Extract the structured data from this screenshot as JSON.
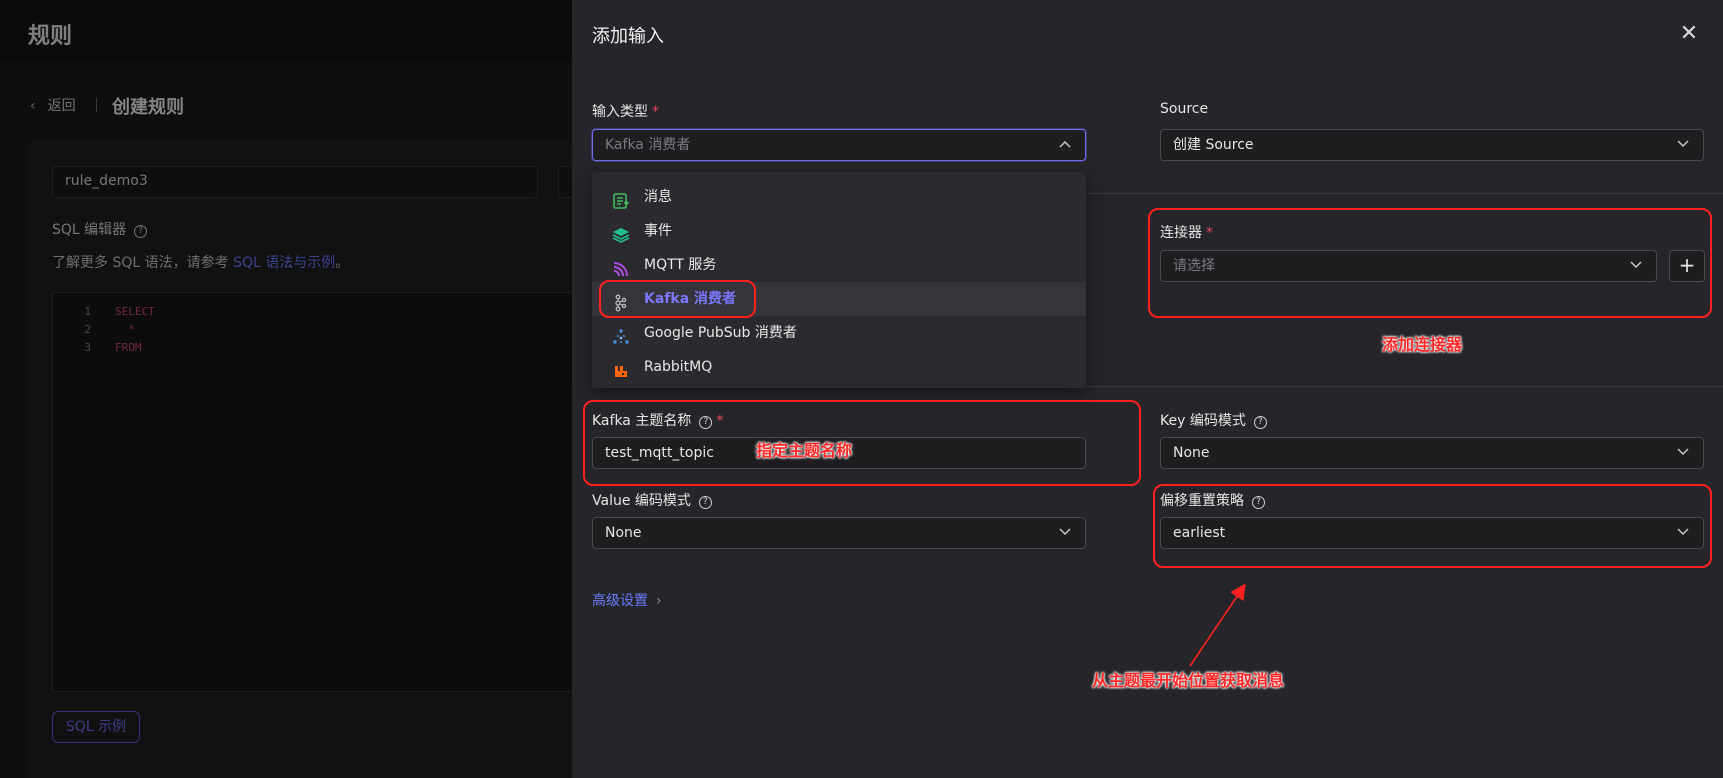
{
  "background": {
    "title": "规则",
    "back_label": "返回",
    "page_title": "创建规则",
    "rule_name": "rule_demo3",
    "sql_editor_label": "SQL 编辑器",
    "sql_help_prefix": "了解更多 SQL 语法，请参考 ",
    "sql_help_link": "SQL 语法与示例",
    "sql_help_suffix": "。",
    "code_lines": [
      {
        "num": "1",
        "text": "SELECT"
      },
      {
        "num": "2",
        "text": "  *"
      },
      {
        "num": "3",
        "text": "FROM"
      }
    ],
    "sql_example_button": "SQL 示例"
  },
  "drawer": {
    "title": "添加输入",
    "close_icon": "close-icon",
    "input_type": {
      "label": "输入类型",
      "placeholder": "Kafka 消费者",
      "options": [
        {
          "label": "消息",
          "icon": "message-icon",
          "color": "#3fbf5f"
        },
        {
          "label": "事件",
          "icon": "layers-icon",
          "color": "#1fbf8f"
        },
        {
          "label": "MQTT 服务",
          "icon": "mqtt-icon",
          "color": "#b04ae0"
        },
        {
          "label": "Kafka 消费者",
          "icon": "kafka-icon",
          "color": "#bbbbbb",
          "active": true
        },
        {
          "label": "Google PubSub 消费者",
          "icon": "pubsub-icon",
          "color": "#4a90e2"
        },
        {
          "label": "RabbitMQ",
          "icon": "rabbitmq-icon",
          "color": "#ff6600"
        }
      ]
    },
    "source": {
      "label": "Source",
      "value": "创建 Source"
    },
    "connector": {
      "label": "连接器",
      "placeholder": "请选择",
      "add_label": "+"
    },
    "kafka_topic": {
      "label": "Kafka 主题名称",
      "value": "test_mqtt_topic"
    },
    "key_encoding": {
      "label": "Key 编码模式",
      "value": "None"
    },
    "value_encoding": {
      "label": "Value 编码模式",
      "value": "None"
    },
    "offset_reset": {
      "label": "偏移重置策略",
      "value": "earliest"
    },
    "advanced_settings": "高级设置"
  },
  "annotations": {
    "add_connector": "添加连接器",
    "topic_name": "指定主题名称",
    "earliest": "从主题最开始位置获取消息",
    "color": "#ff2020"
  }
}
